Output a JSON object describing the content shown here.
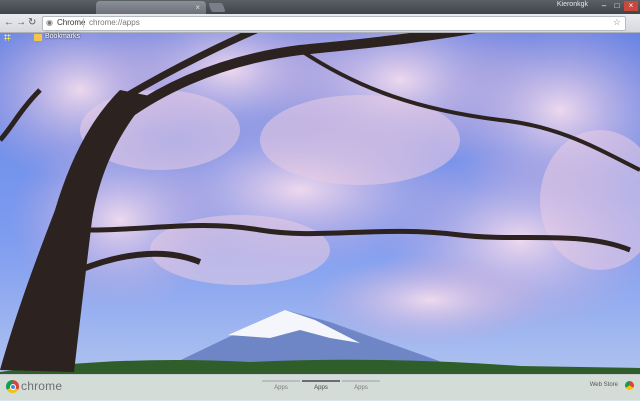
{
  "browser": {
    "tab_title": "",
    "profile_name": "Kieronkgk",
    "omnibox": {
      "scheme_label": "Chrome",
      "url": "chrome://apps"
    },
    "bookmarks": [
      {
        "label": "Bookmarks"
      }
    ]
  },
  "footer": {
    "brand": "chrome",
    "pages": [
      {
        "label": "Apps"
      },
      {
        "label": "Apps"
      },
      {
        "label": "Apps"
      }
    ],
    "active_page": 2,
    "webstore_label": "Web Store"
  },
  "colors": {
    "sky": "#5d86e6",
    "blossom": "#e7c6df",
    "trunk": "#2c2220"
  }
}
